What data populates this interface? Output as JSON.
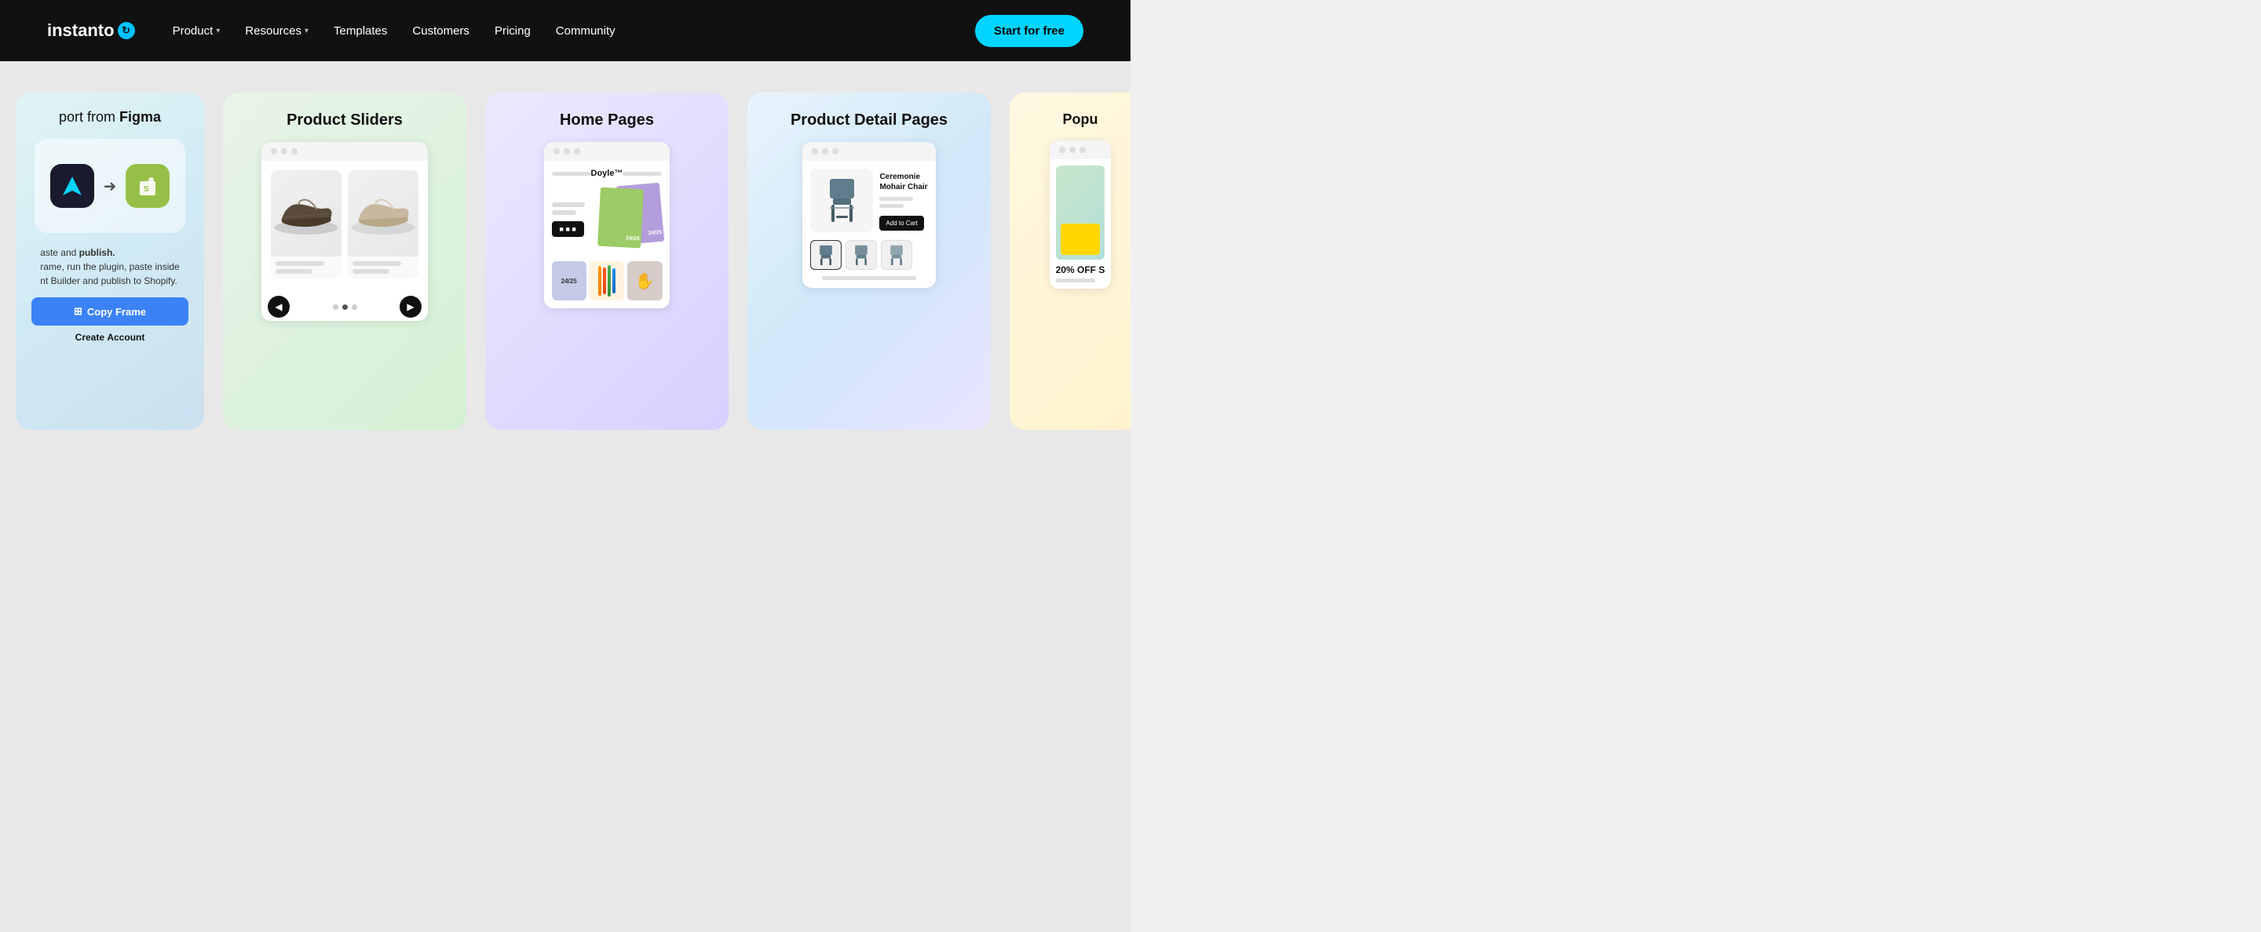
{
  "nav": {
    "logo_text": "instanto",
    "logo_symbol": "⟳",
    "items": [
      {
        "label": "Product",
        "has_dropdown": true
      },
      {
        "label": "Resources",
        "has_dropdown": true
      },
      {
        "label": "Templates",
        "has_dropdown": false
      },
      {
        "label": "Customers",
        "has_dropdown": false
      },
      {
        "label": "Pricing",
        "has_dropdown": false
      },
      {
        "label": "Community",
        "has_dropdown": false
      }
    ],
    "cta_label": "Start for free"
  },
  "cards": [
    {
      "id": "figma",
      "title_prefix": "port from ",
      "title_bold": "Figma",
      "desc_part1": "aste and ",
      "desc_bold1": "publish.",
      "desc_part2": "rame, run the plugin, paste inside",
      "desc_part3": "nt Builder and publish to Shopify.",
      "copy_frame_label": "Copy Frame",
      "create_account_prefix": "Create ",
      "create_account_bold": "Account"
    },
    {
      "id": "sliders",
      "title": "Product Sliders"
    },
    {
      "id": "home-pages",
      "title": "Home Pages",
      "brand": "Doyle™",
      "cta": "24/25"
    },
    {
      "id": "pdp",
      "title": "Product Detail Pages",
      "product_name": "Ceremonie\nMohair Chair",
      "add_to_cart_label": "Add to Cart"
    },
    {
      "id": "popup",
      "title": "Popu",
      "offer_text": "20% OFF S"
    }
  ],
  "icons": {
    "copy_icon": "⊞",
    "shopify_icon": "S",
    "instant_icon": "⚡"
  }
}
